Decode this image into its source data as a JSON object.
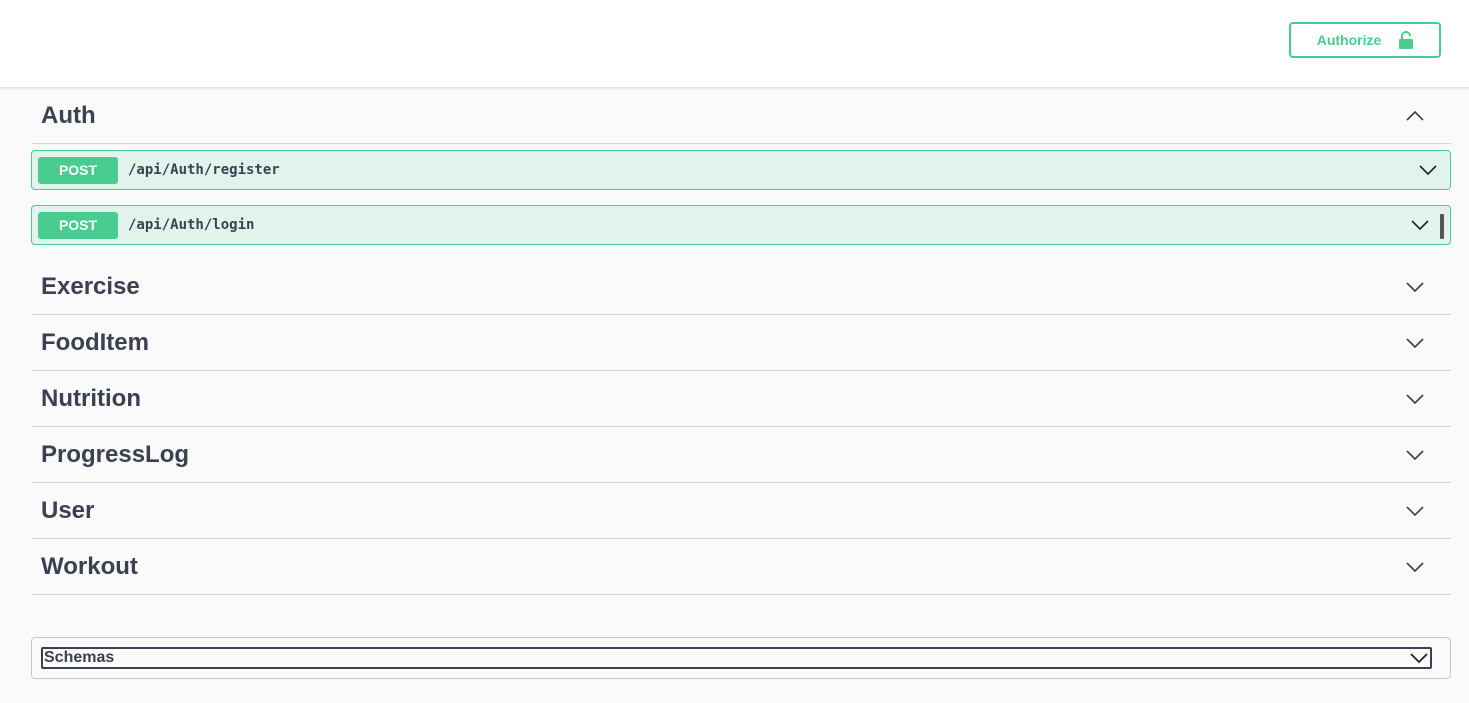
{
  "topbar": {
    "authorize_label": "Authorize",
    "authorize_icon": "unlocked-lock-icon",
    "accent": "#49cc90"
  },
  "tags": [
    {
      "name": "Auth",
      "expanded": true,
      "operations": [
        {
          "method": "POST",
          "path": "/api/Auth/register"
        },
        {
          "method": "POST",
          "path": "/api/Auth/login"
        }
      ]
    },
    {
      "name": "Exercise",
      "expanded": false
    },
    {
      "name": "FoodItem",
      "expanded": false
    },
    {
      "name": "Nutrition",
      "expanded": false
    },
    {
      "name": "ProgressLog",
      "expanded": false
    },
    {
      "name": "User",
      "expanded": false
    },
    {
      "name": "Workout",
      "expanded": false
    }
  ],
  "schemas": {
    "label": "Schemas"
  },
  "colors": {
    "post_method": "#49cc90",
    "text": "#3b4151"
  }
}
